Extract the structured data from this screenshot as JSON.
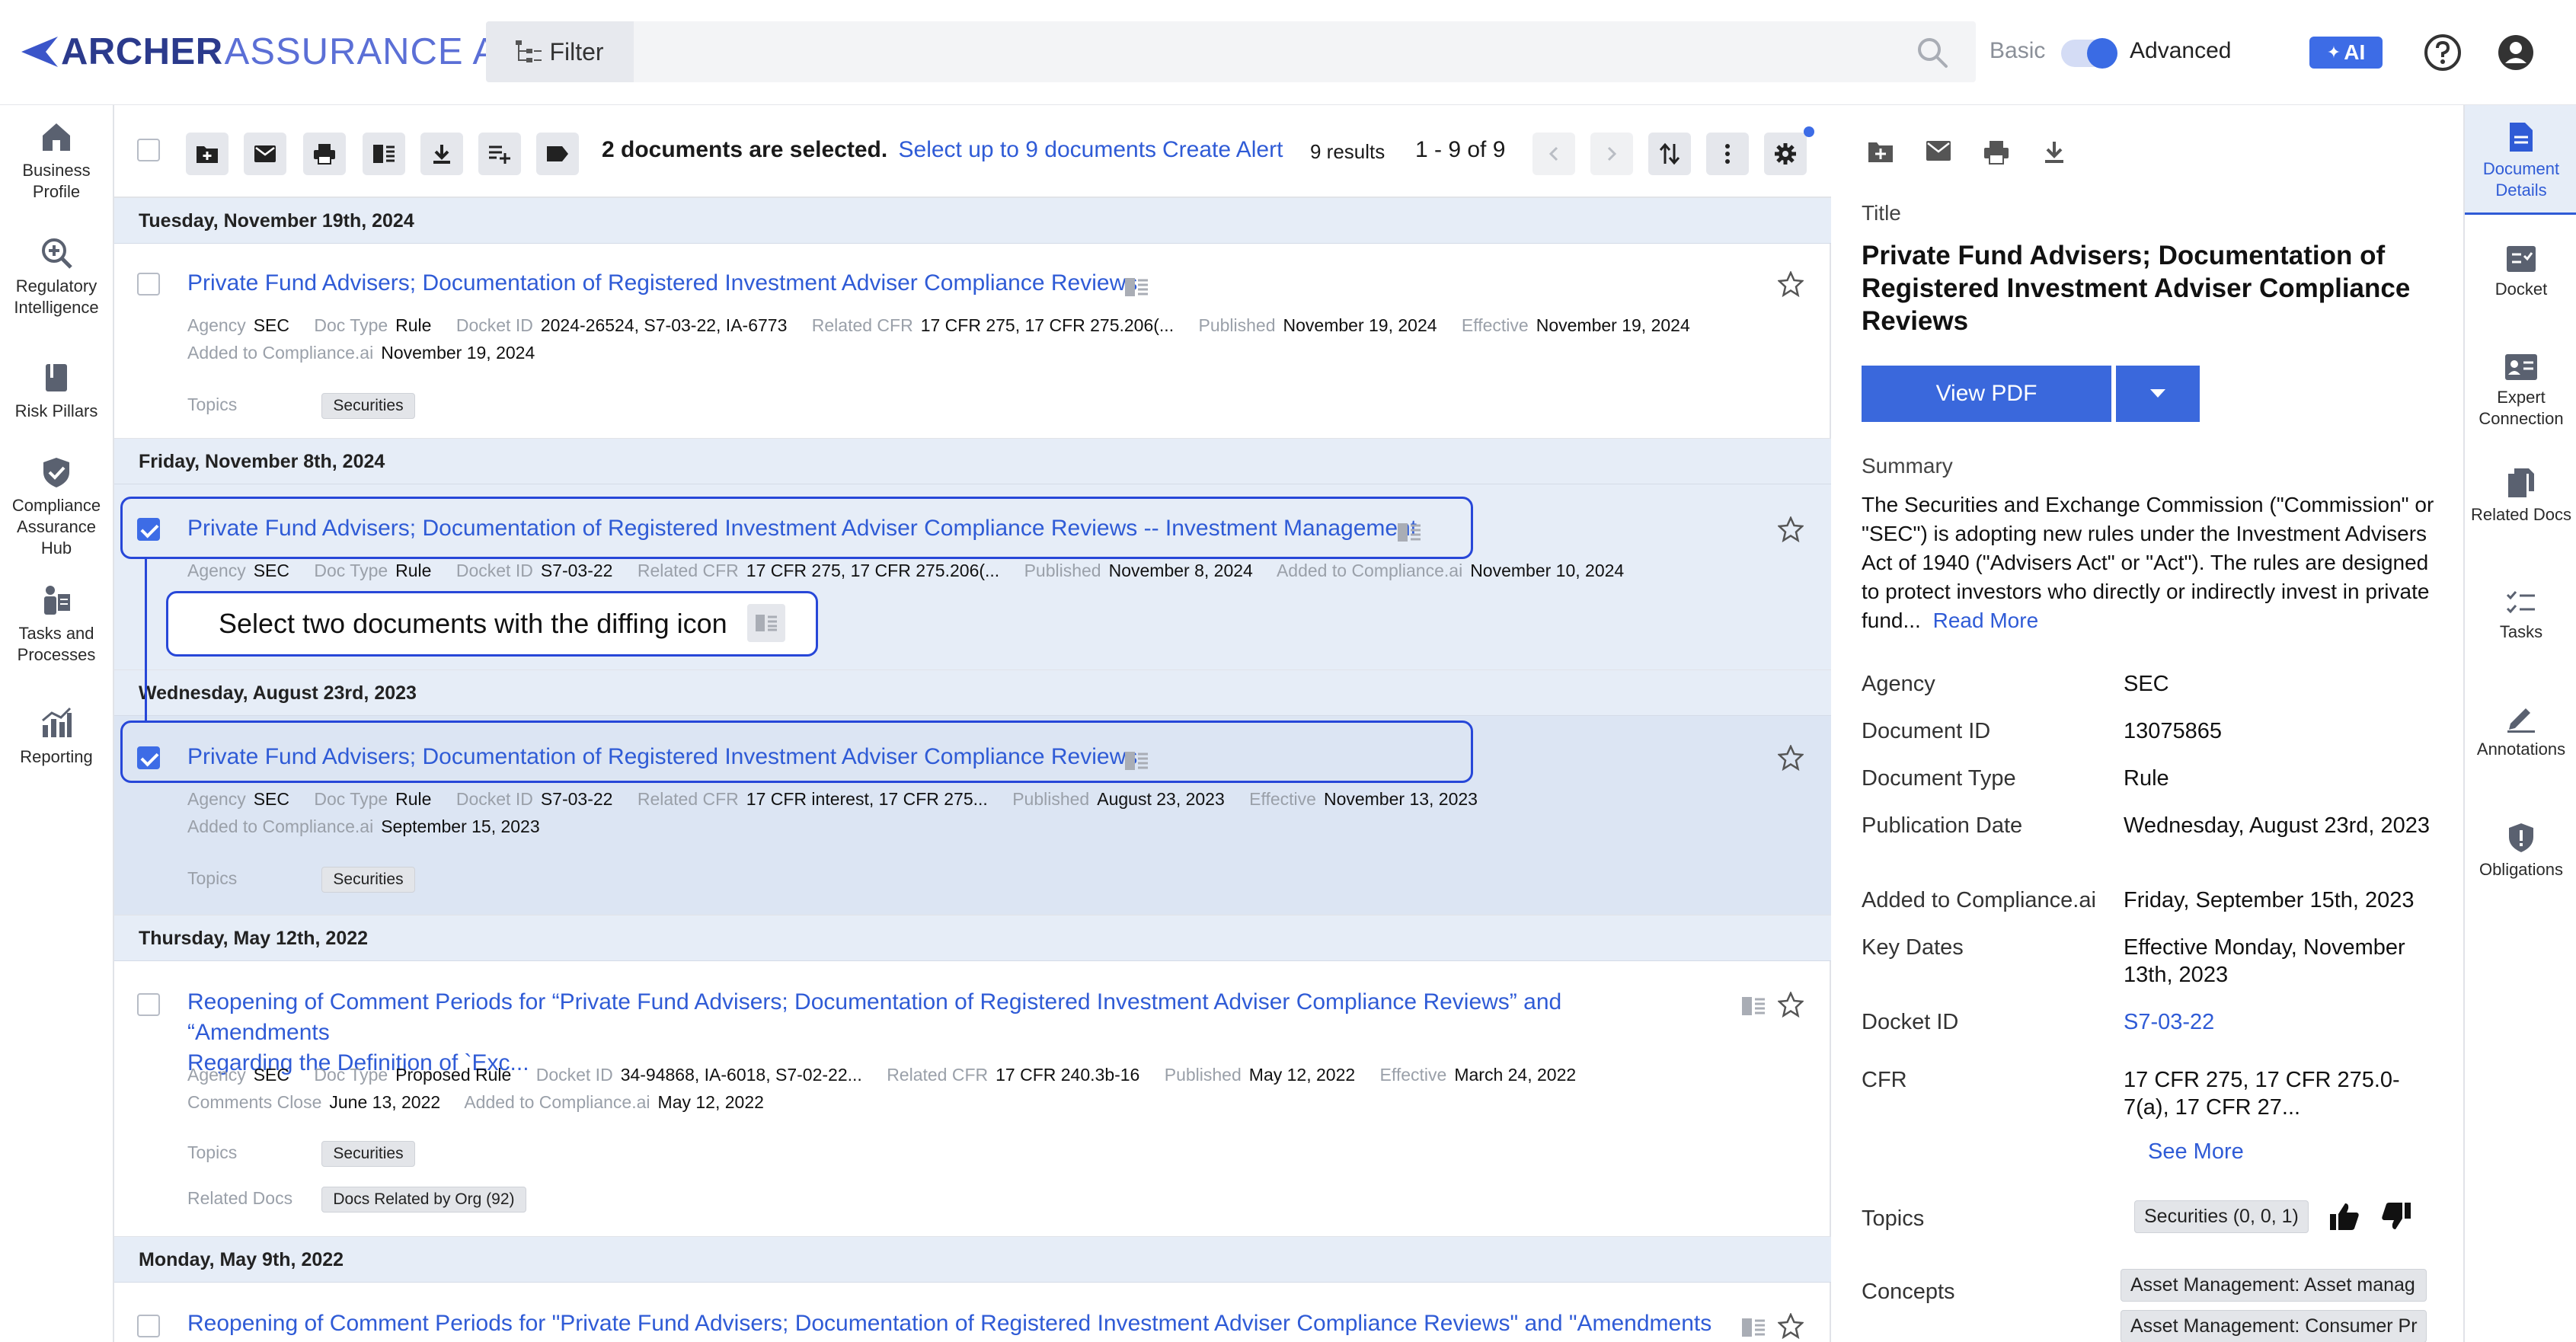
{
  "app": {
    "logo_bold": "ARCHER",
    "logo_light": "ASSURANCE AI",
    "filter_label": "Filter",
    "mode_basic": "Basic",
    "mode_advanced": "Advanced",
    "ai_label": "AI"
  },
  "leftnav": [
    {
      "label": "Business Profile",
      "icon": "building-icon"
    },
    {
      "label": "Regulatory Intelligence",
      "icon": "magnify-plus-icon"
    },
    {
      "label": "Risk Pillars",
      "icon": "book-icon"
    },
    {
      "label": "Compliance Assurance Hub",
      "icon": "shield-check-icon"
    },
    {
      "label": "Tasks and Processes",
      "icon": "person-clipboard-icon"
    },
    {
      "label": "Reporting",
      "icon": "chart-icon"
    }
  ],
  "toolbar": {
    "selected_text": "2 documents are selected.",
    "select_up_to": "Select up to 9 documents",
    "create_alert": "Create Alert",
    "results": "9 results",
    "page_range": "1 - 9 of 9"
  },
  "groups": [
    {
      "date": "Tuesday, November 19th, 2024",
      "title": "Private Fund Advisers; Documentation of Registered Investment Adviser Compliance Reviews",
      "meta1": [
        [
          "Agency",
          "SEC"
        ],
        [
          "Doc Type",
          "Rule"
        ],
        [
          "Docket ID",
          "2024-26524, S7-03-22, IA-6773"
        ],
        [
          "Related CFR",
          "17 CFR 275, 17 CFR 275.206(..."
        ],
        [
          "Published",
          "November 19, 2024"
        ],
        [
          "Effective",
          "November 19, 2024"
        ]
      ],
      "meta2": [
        [
          "Added to Compliance.ai",
          "November 19, 2024"
        ]
      ],
      "topics_label": "Topics",
      "topics": "Securities"
    },
    {
      "date": "Friday, November 8th, 2024",
      "title": "Private Fund Advisers; Documentation of Registered Investment Adviser Compliance Reviews -- Investment Management",
      "meta1": [
        [
          "Agency",
          "SEC"
        ],
        [
          "Doc Type",
          "Rule"
        ],
        [
          "Docket ID",
          "S7-03-22"
        ],
        [
          "Related CFR",
          "17 CFR 275, 17 CFR 275.206(..."
        ],
        [
          "Published",
          "November 8, 2024"
        ],
        [
          "Added to Compliance.ai",
          "November 10, 2024"
        ]
      ]
    },
    {
      "date": "Wednesday, August 23rd, 2023",
      "title": "Private Fund Advisers; Documentation of Registered Investment Adviser Compliance Reviews",
      "meta1": [
        [
          "Agency",
          "SEC"
        ],
        [
          "Doc Type",
          "Rule"
        ],
        [
          "Docket ID",
          "S7-03-22"
        ],
        [
          "Related CFR",
          "17 CFR interest, 17 CFR 275..."
        ],
        [
          "Published",
          "August 23, 2023"
        ],
        [
          "Effective",
          "November 13, 2023"
        ]
      ],
      "meta2": [
        [
          "Added to Compliance.ai",
          "September 15, 2023"
        ]
      ],
      "topics_label": "Topics",
      "topics": "Securities"
    },
    {
      "date": "Thursday, May 12th, 2022",
      "title_line1": "Reopening of Comment Periods for “Private Fund Advisers; Documentation of Registered Investment Adviser Compliance Reviews” and “Amendments",
      "title_line2": "Regarding the Definition of `Exc...",
      "meta1": [
        [
          "Agency",
          "SEC"
        ],
        [
          "Doc Type",
          "Proposed Rule"
        ],
        [
          "Docket ID",
          "34-94868, IA-6018, S7-02-22..."
        ],
        [
          "Related CFR",
          "17 CFR 240.3b-16"
        ],
        [
          "Published",
          "May 12, 2022"
        ],
        [
          "Effective",
          "March 24, 2022"
        ]
      ],
      "meta2": [
        [
          "Comments Close",
          "June 13, 2022"
        ],
        [
          "Added to Compliance.ai",
          "May 12, 2022"
        ]
      ],
      "topics_label": "Topics",
      "topics": "Securities",
      "related_label": "Related Docs",
      "related": "Docs Related by Org (92)"
    },
    {
      "date": "Monday, May 9th, 2022",
      "title": "Reopening of Comment Periods for \"Private Fund Advisers; Documentation of Registered Investment Adviser Compliance Reviews\" and \"Amendments"
    }
  ],
  "callout": "Select two documents with the diffing icon",
  "detail": {
    "title_label": "Title",
    "title": "Private Fund Advisers; Documentation of Registered Investment Adviser Compliance Reviews",
    "view_pdf": "View PDF",
    "summary_label": "Summary",
    "summary": "The Securities and Exchange Commission (\"Commission\" or \"SEC\") is adopting new rules under the Investment Advisers Act of 1940 (\"Advisers Act\" or \"Act\"). The rules are designed to protect investors who directly or indirectly invest in private fund...",
    "read_more": "Read More",
    "fields": {
      "agency_k": "Agency",
      "agency_v": "SEC",
      "docid_k": "Document ID",
      "docid_v": "13075865",
      "doctype_k": "Document Type",
      "doctype_v": "Rule",
      "pubdate_k": "Publication Date",
      "pubdate_v": "Wednesday, August 23rd, 2023",
      "added_k": "Added to Compliance.ai",
      "added_v": "Friday, September 15th, 2023",
      "keydates_k": "Key Dates",
      "keydates_v": "Effective Monday, November 13th, 2023",
      "docket_k": "Docket ID",
      "docket_v": "S7-03-22",
      "cfr_k": "CFR",
      "cfr_v": "17 CFR 275, 17 CFR 275.0-7(a), 17 CFR 27...",
      "see_more": "See More",
      "topics_k": "Topics",
      "topics_v": "Securities (0, 0, 1)",
      "concepts_k": "Concepts",
      "concept1": "Asset Management: Asset manag",
      "concept2": "Asset Management: Consumer Pr"
    }
  },
  "rightrail": [
    {
      "label": "Document Details",
      "icon": "document-icon",
      "active": true
    },
    {
      "label": "Docket",
      "icon": "docket-icon"
    },
    {
      "label": "Expert Connection",
      "icon": "id-card-icon"
    },
    {
      "label": "Related Docs",
      "icon": "copy-icon"
    },
    {
      "label": "Tasks",
      "icon": "checklist-icon"
    },
    {
      "label": "Annotations",
      "icon": "pen-icon"
    },
    {
      "label": "Obligations",
      "icon": "shield-alert-icon"
    }
  ],
  "colors": {
    "accent": "#3d6ce6",
    "link": "#2f5bd6",
    "callout": "#2747d8",
    "date_bg": "#e6edf7",
    "selected_row": "#dce5f3"
  }
}
